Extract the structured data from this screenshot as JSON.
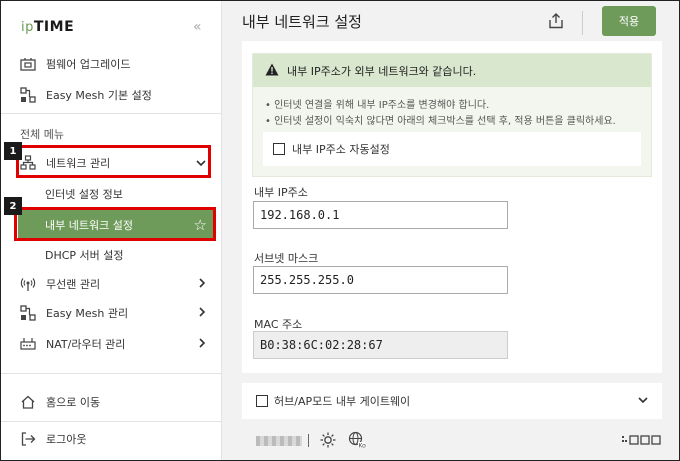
{
  "brand": {
    "logo_ip": "ip",
    "logo_time": "TIME"
  },
  "sidebar": {
    "top_items": [
      {
        "label": "펌웨어 업그레이드",
        "icon": "firmware-icon"
      },
      {
        "label": "Easy Mesh 기본 설정",
        "icon": "mesh-icon"
      }
    ],
    "section_label": "전체 메뉴",
    "network": {
      "label": "네트워크 관리",
      "icon": "network-icon",
      "expanded": true
    },
    "network_sub": [
      {
        "label": "인터넷 설정 정보"
      },
      {
        "label": "내부 네트워크 설정",
        "active": true
      },
      {
        "label": "DHCP 서버 설정"
      }
    ],
    "menu_items": [
      {
        "label": "무선랜 관리",
        "icon": "wireless-icon"
      },
      {
        "label": "Easy Mesh 관리",
        "icon": "mesh-icon"
      },
      {
        "label": "NAT/라우터 관리",
        "icon": "router-icon"
      }
    ],
    "home": {
      "label": "홈으로 이동",
      "icon": "home-icon"
    },
    "logout": {
      "label": "로그아웃",
      "icon": "logout-icon"
    }
  },
  "annotations": {
    "badge1": "1",
    "badge2": "2"
  },
  "header": {
    "title": "내부 네트워크 설정",
    "apply_label": "적용"
  },
  "notice": {
    "title": "내부 IP주소가 외부 네트워크와 같습니다.",
    "lines": [
      "• 인터넷 연결을 위해 내부 IP주소를 변경해야 합니다.",
      "• 인터넷 설정이 익숙치 않다면 아래의 체크박스를 선택 후, 적용 버튼을 클릭하세요."
    ],
    "auto_label": "내부 IP주소 자동설정"
  },
  "form": {
    "ip_label": "내부 IP주소",
    "ip_value": "192.168.0.1",
    "subnet_label": "서브넷 마스크",
    "subnet_value": "255.255.255.0",
    "mac_label": "MAC 주소",
    "mac_value": "B0:38:6C:02:28:67"
  },
  "hub_section": {
    "label": "허브/AP모드 내부 게이트웨이"
  },
  "colors": {
    "accent": "#6e9a5a",
    "highlight": "#e00000"
  }
}
